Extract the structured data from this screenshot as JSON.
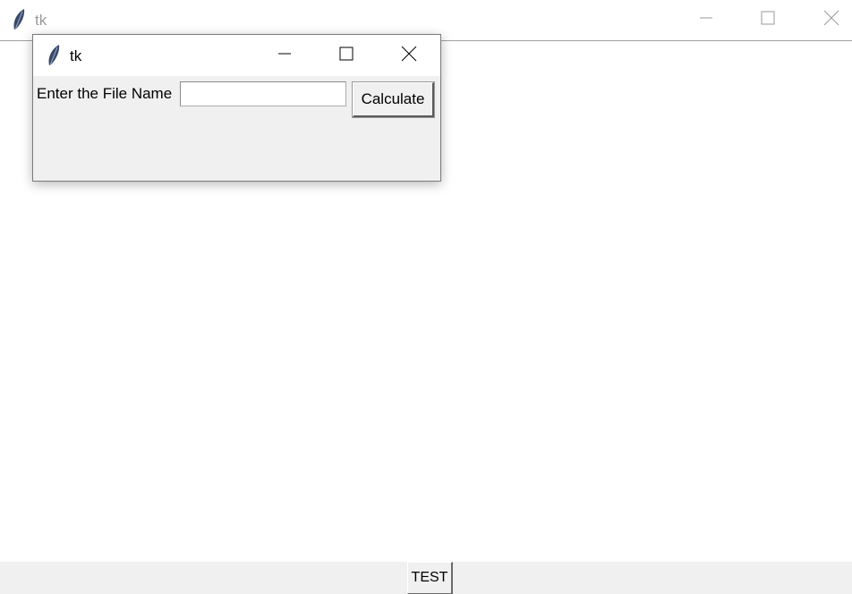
{
  "main_window": {
    "title": "tk",
    "icon": "feather-icon",
    "controls": [
      "minimize-icon",
      "maximize-icon",
      "close-icon"
    ],
    "bottom_button_label": "TEST"
  },
  "dialog": {
    "title": "tk",
    "icon": "feather-icon",
    "controls": [
      "minimize-icon",
      "maximize-icon",
      "close-icon"
    ],
    "file_label": "Enter the File Name",
    "file_input_value": "",
    "calculate_label": "Calculate"
  },
  "colors": {
    "window_bg": "#f0f0f0",
    "titlebar_bg": "#ffffff",
    "inactive_title": "#9a9a9a"
  }
}
